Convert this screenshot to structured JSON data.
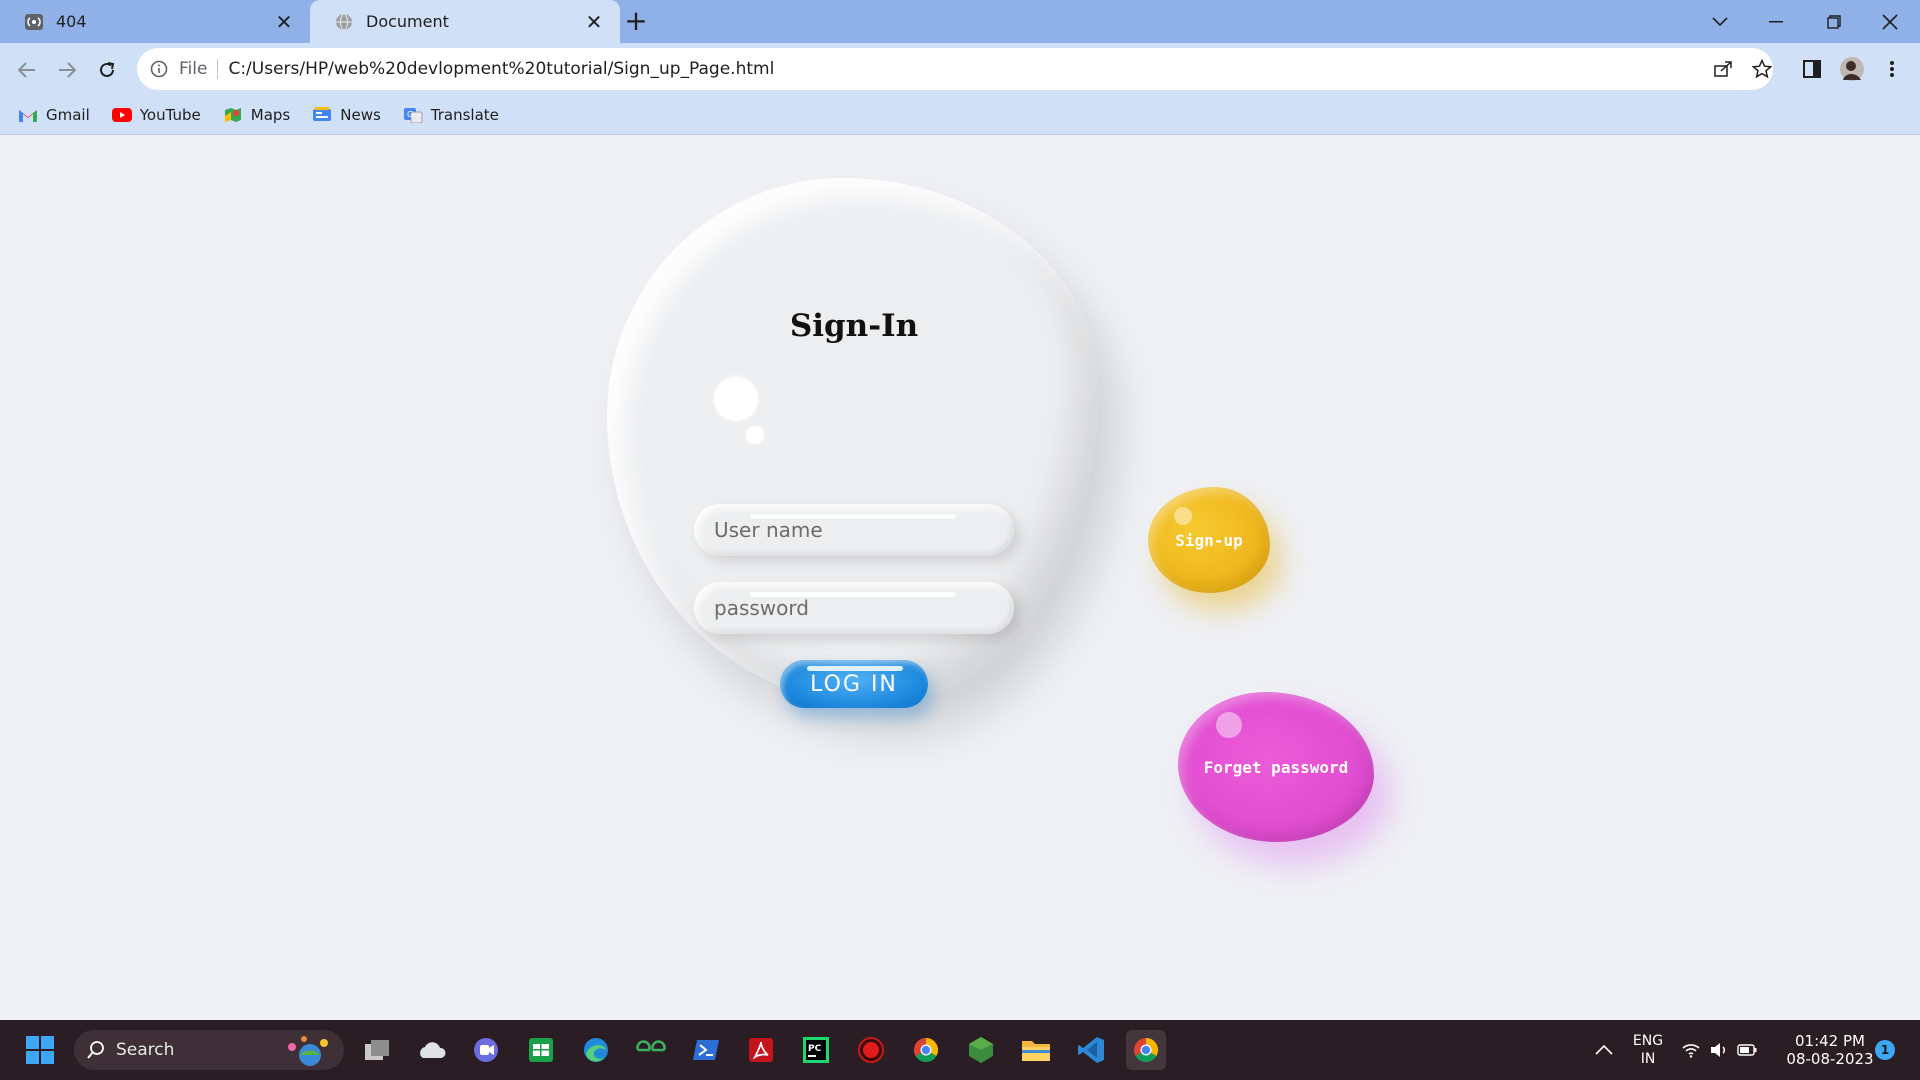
{
  "browser": {
    "tabs": [
      {
        "title": "404",
        "icon": "podcast-icon",
        "active": false
      },
      {
        "title": "Document",
        "icon": "globe-icon",
        "active": true
      }
    ],
    "address": {
      "scheme": "File",
      "url": "C:/Users/HP/web%20devlopment%20tutorial/Sign_up_Page.html"
    },
    "bookmarks": [
      {
        "label": "Gmail",
        "icon": "gmail-icon"
      },
      {
        "label": "YouTube",
        "icon": "youtube-icon"
      },
      {
        "label": "Maps",
        "icon": "maps-icon"
      },
      {
        "label": "News",
        "icon": "news-icon"
      },
      {
        "label": "Translate",
        "icon": "translate-icon"
      }
    ]
  },
  "page": {
    "title": "Sign-In",
    "username_placeholder": "User name",
    "password_placeholder": "password",
    "login_label": "LOG IN",
    "signup_label": "Sign-up",
    "forgot_label": "Forget password",
    "colors": {
      "background": "#eef0f4",
      "login": "#1a86dc",
      "signup": "#eeb418",
      "forgot": "#e04bd0"
    }
  },
  "taskbar": {
    "search_label": "Search",
    "language": "ENG",
    "region": "IN",
    "time": "01:42 PM",
    "date": "08-08-2023",
    "notification_count": "1"
  }
}
